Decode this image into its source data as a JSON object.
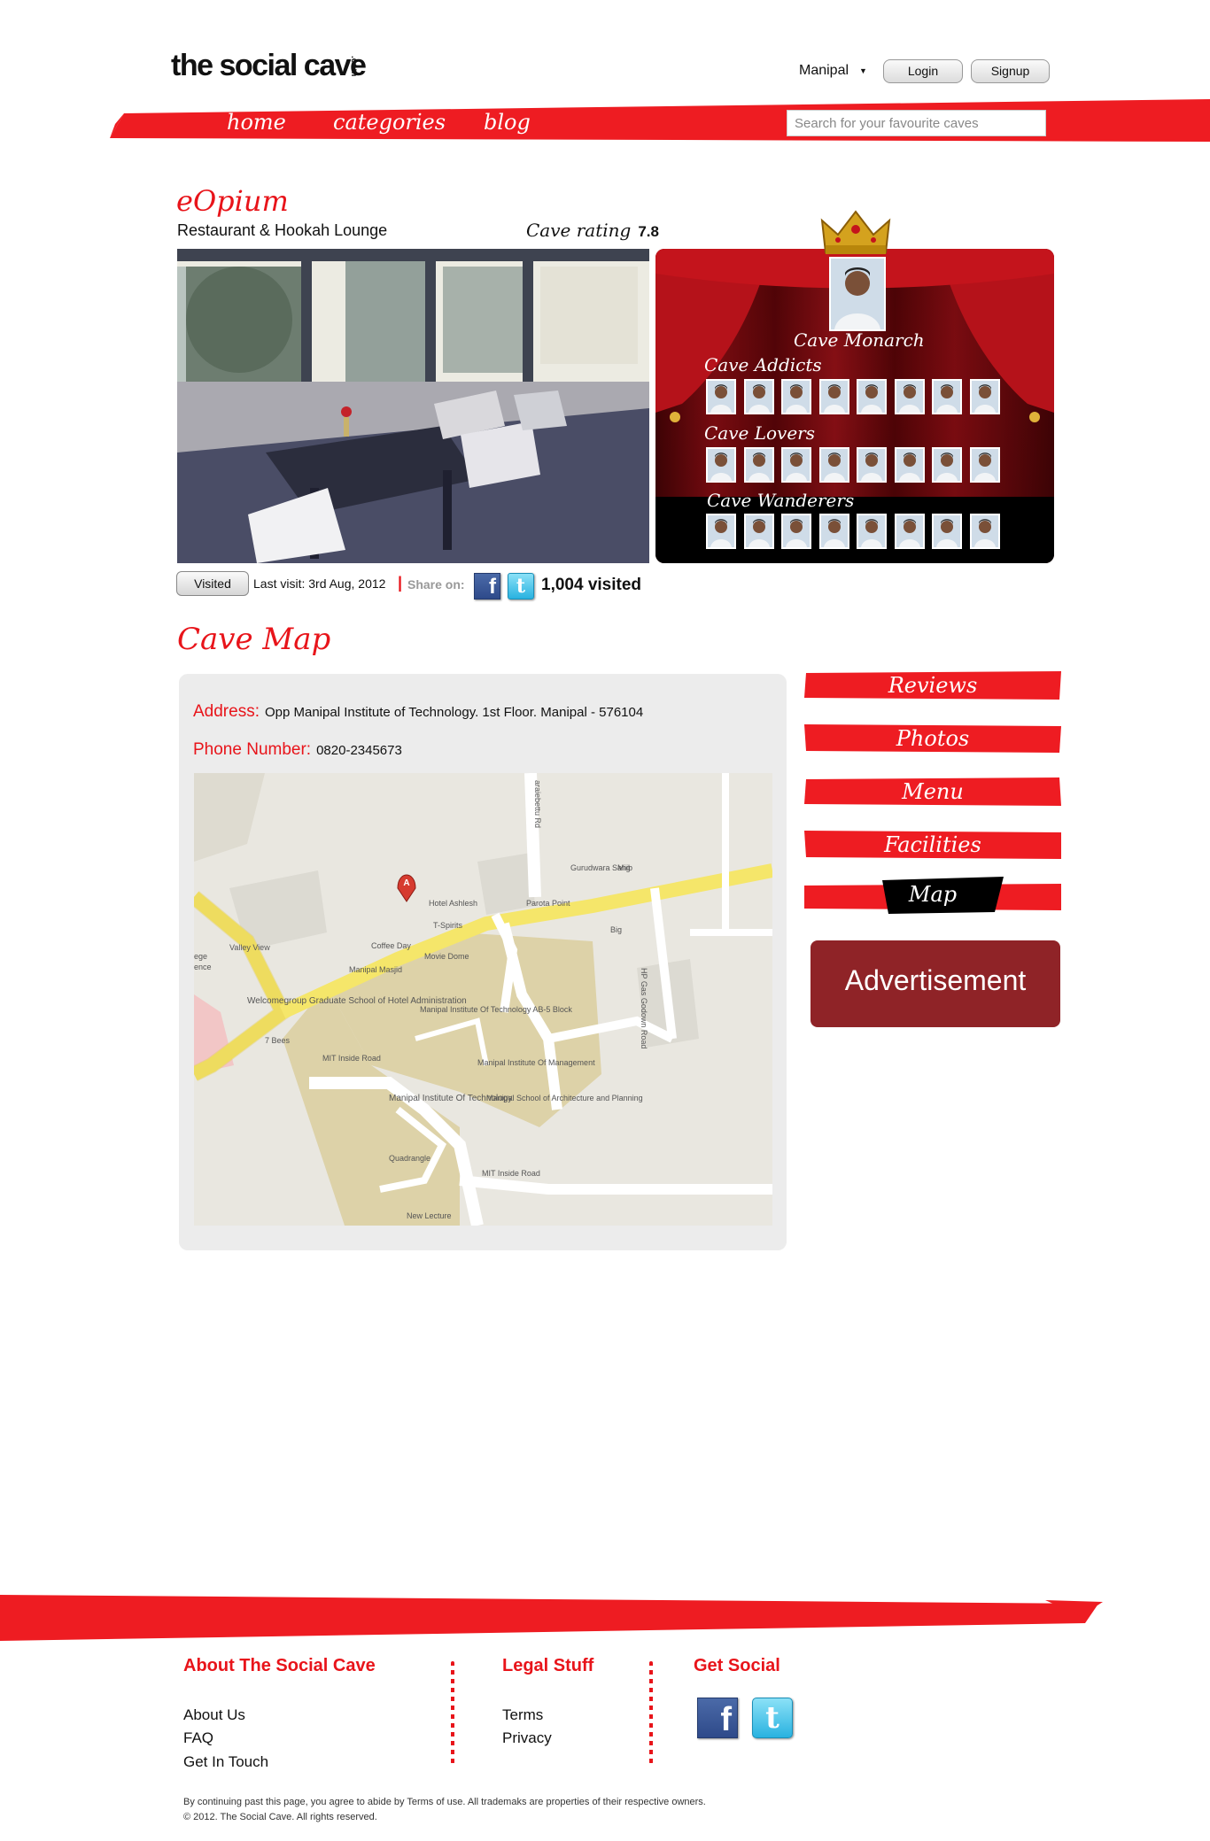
{
  "header": {
    "logo": "the social cave",
    "logo_suffix": ".com",
    "city": "Manipal",
    "login": "Login",
    "signup": "Signup",
    "nav": [
      "home",
      "categories",
      "blog"
    ],
    "search_placeholder": "Search for your favourite caves"
  },
  "cave": {
    "name": "eOpium",
    "type": "Restaurant & Hookah Lounge",
    "rating_label": "Cave rating",
    "rating_value": "7.8",
    "tiers": {
      "monarch": "Cave Monarch",
      "addicts": "Cave Addicts",
      "lovers": "Cave Lovers",
      "wanderers": "Cave Wanderers"
    },
    "visited_button": "Visited",
    "last_visit": "Last visit: 3rd Aug, 2012",
    "share_label": "Share on:",
    "visited_count": "1,004 visited"
  },
  "map_section": {
    "title": "Cave Map",
    "address_label": "Address:",
    "address": "Opp Manipal Institute of Technology. 1st Floor. Manipal - 576104",
    "phone_label": "Phone Number:",
    "phone": "0820-2345673",
    "map_labels": {
      "road_top": "araiebettu Rd",
      "gurudwara": "Gurudwara Sahib",
      "parota": "Parota Point",
      "hotel": "Hotel Ashlesh",
      "tspirits": "T-Spirits",
      "coffee": "Coffee Day",
      "masjid": "Manipal Masjid",
      "movie": "Movie Dome",
      "valley": "Valley View",
      "welcome": "Welcomegroup Graduate School of Hotel Administration",
      "mit_block": "Manipal Institute Of Technology AB-5 Block",
      "mit_mgmt": "Manipal Institute Of Management",
      "godown": "HP Gas Godown Road",
      "bees": "7 Bees",
      "inside1": "MIT Inside Road",
      "inside2": "MIT Inside Road",
      "mit": "Manipal Institute Of Technology",
      "arch": "Manipal School of Architecture and Planning",
      "quadrangle": "Quadrangle",
      "lecture": "New Lecture",
      "mig": "Mig",
      "big": "Big",
      "ege": "ege",
      "ence": "ence"
    }
  },
  "sidebar": {
    "tabs": [
      "Reviews",
      "Photos",
      "Menu",
      "Facilities",
      "Map"
    ],
    "active_tab": "Map",
    "advertisement": "Advertisement"
  },
  "footer": {
    "about_title": "About The Social Cave",
    "about_links": [
      "About Us",
      "FAQ",
      "Get In Touch"
    ],
    "legal_title": "Legal Stuff",
    "legal_links": [
      "Terms",
      "Privacy"
    ],
    "social_title": "Get Social",
    "legal_text": "By continuing past this page, you agree to abide by Terms of use. All trademaks are properties of their respective owners.",
    "copyright": "© 2012. The Social Cave. All rights reserved."
  },
  "colors": {
    "brand_red": "#e8141a",
    "ad_bg": "#8f2327",
    "panel_bg": "#ececec"
  }
}
